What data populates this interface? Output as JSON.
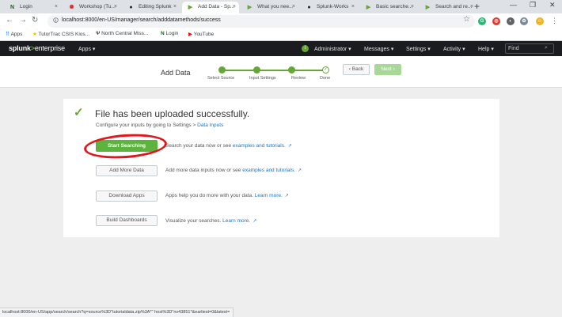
{
  "browser": {
    "tabs": [
      {
        "label": "Login",
        "icon": "N",
        "icon_color": "#1b5e20"
      },
      {
        "label": "Workshop (Tu...",
        "icon": "✺",
        "icon_color": "#d32f2f"
      },
      {
        "label": "Editing Splunk",
        "icon": "●",
        "icon_color": "#222222"
      },
      {
        "label": "Add Data - Sp...",
        "icon": "▶",
        "icon_color": "#65a637"
      },
      {
        "label": "What you nee...",
        "icon": "▶",
        "icon_color": "#65a637"
      },
      {
        "label": "Splunk-Works",
        "icon": "●",
        "icon_color": "#222222"
      },
      {
        "label": "Basic searche...",
        "icon": "▶",
        "icon_color": "#65a637"
      },
      {
        "label": "Search and re...",
        "icon": "▶",
        "icon_color": "#65a637"
      }
    ],
    "active_tab": 3,
    "new_tab": "+",
    "url": "localhost:8000/en-US/manager/search/adddatamethods/success",
    "bookmarks": [
      {
        "label": "Apps",
        "icon": "apps-grid-icon"
      },
      {
        "label": "TutorTrac CSIS Kios...",
        "icon": "star-icon"
      },
      {
        "label": "North Central Miss...",
        "icon": "ncm-logo-icon"
      },
      {
        "label": "Login",
        "icon": "n-logo-icon"
      },
      {
        "label": "YouTube",
        "icon": "youtube-icon"
      }
    ],
    "status_url": "localhost:8000/en-US/app/search/search?q=source%3D\"tutorialdata.zip%3A*\" host%3D\"nv43851*&earliest=0&latest="
  },
  "splunk_nav": {
    "logo_prefix": "splunk",
    "logo_gt": ">",
    "logo_suffix": "enterprise",
    "apps": "Apps ▾",
    "user": "Administrator ▾",
    "messages": "Messages ▾",
    "settings": "Settings ▾",
    "activity": "Activity ▾",
    "help": "Help ▾",
    "find_placeholder": "Find"
  },
  "wizard": {
    "title": "Add Data",
    "steps": [
      "Select Source",
      "Input Settings",
      "Review",
      "Done"
    ],
    "back_label": "‹ Back",
    "next_label": "Next ›"
  },
  "success": {
    "title": "File has been uploaded successfully.",
    "subtitle_prefix": "Configure your inputs by going to Settings > ",
    "subtitle_link": "Data Inputs"
  },
  "actions": [
    {
      "button": "Start Searching",
      "text": "Search your data now or see ",
      "link": "examples and tutorials."
    },
    {
      "button": "Add More Data",
      "text": "Add more data inputs now or see ",
      "link": "examples and tutorials."
    },
    {
      "button": "Download Apps",
      "text": "Apps help you do more with your data. ",
      "link": "Learn more."
    },
    {
      "button": "Build Dashboards",
      "text": "Visualize your searches. ",
      "link": "Learn more."
    }
  ],
  "colors": {
    "splunk_green": "#65a637",
    "annotation_red": "#e0181c",
    "link_blue": "#1e73c1"
  }
}
